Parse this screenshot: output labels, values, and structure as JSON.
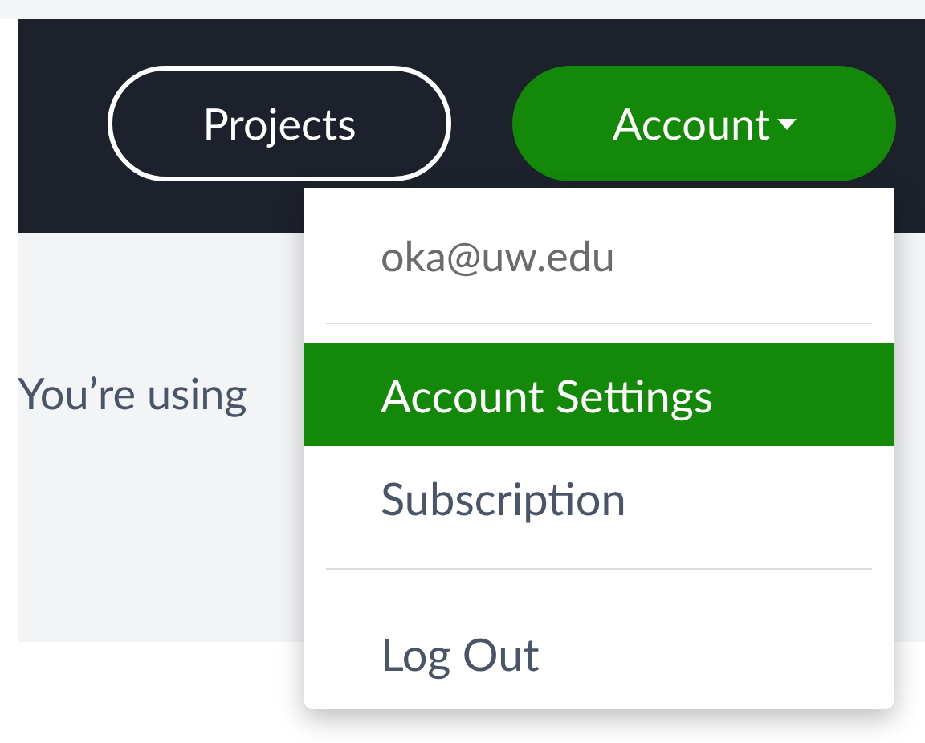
{
  "navbar": {
    "buttons": [
      {
        "label": "Projects",
        "kind": "outline"
      },
      {
        "label": "Account",
        "kind": "dropdown"
      }
    ]
  },
  "page": {
    "notice": "You’re using"
  },
  "account_menu": {
    "email": "oka@uw.edu",
    "items": [
      {
        "label": "Account Settings",
        "selected": true
      },
      {
        "label": "Subscription",
        "selected": false
      },
      {
        "label": "Log Out",
        "selected": false
      }
    ]
  }
}
